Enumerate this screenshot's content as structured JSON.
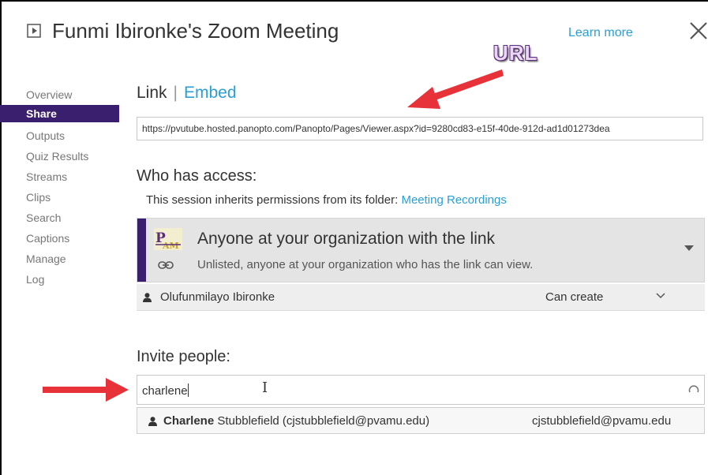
{
  "window": {
    "title": "Funmi Ibironke's Zoom Meeting",
    "learn_more": "Learn more"
  },
  "sidebar": {
    "items": [
      {
        "label": "Overview"
      },
      {
        "label": "Share"
      },
      {
        "label": "Outputs"
      },
      {
        "label": "Quiz Results"
      },
      {
        "label": "Streams"
      },
      {
        "label": "Clips"
      },
      {
        "label": "Search"
      },
      {
        "label": "Captions"
      },
      {
        "label": "Manage"
      },
      {
        "label": "Log"
      }
    ],
    "active": "Share"
  },
  "tabs": {
    "link": "Link",
    "separator": "|",
    "embed": "Embed"
  },
  "url": {
    "value": "https://pvutube.hosted.panopto.com/Panopto/Pages/Viewer.aspx?id=9280cd83-e15f-40de-912d-ad1d01273dea"
  },
  "access": {
    "title": "Who has access:",
    "inherit_text": "This session inherits permissions from its folder:",
    "folder_link": "Meeting Recordings",
    "option_main": "Anyone at your organization with the link",
    "option_sub": "Unlisted, anyone at your organization who has the link can view.",
    "logo_icon": "pvamu-logo",
    "owner": {
      "name": "Olufunmilayo Ibironke",
      "permission": "Can create"
    }
  },
  "invite": {
    "title": "Invite people:",
    "input_value": "charlene",
    "suggestion": {
      "name_bold": "Charlene",
      "name_rest": "Stubblefield (cjstubblefield@pvamu.edu)",
      "email": "cjstubblefield@pvamu.edu"
    }
  },
  "annotations": {
    "url_label": "URL",
    "arrow_color": "#e8323a"
  },
  "colors": {
    "accent": "#2a9fd6",
    "brand": "#3b1f6f"
  }
}
